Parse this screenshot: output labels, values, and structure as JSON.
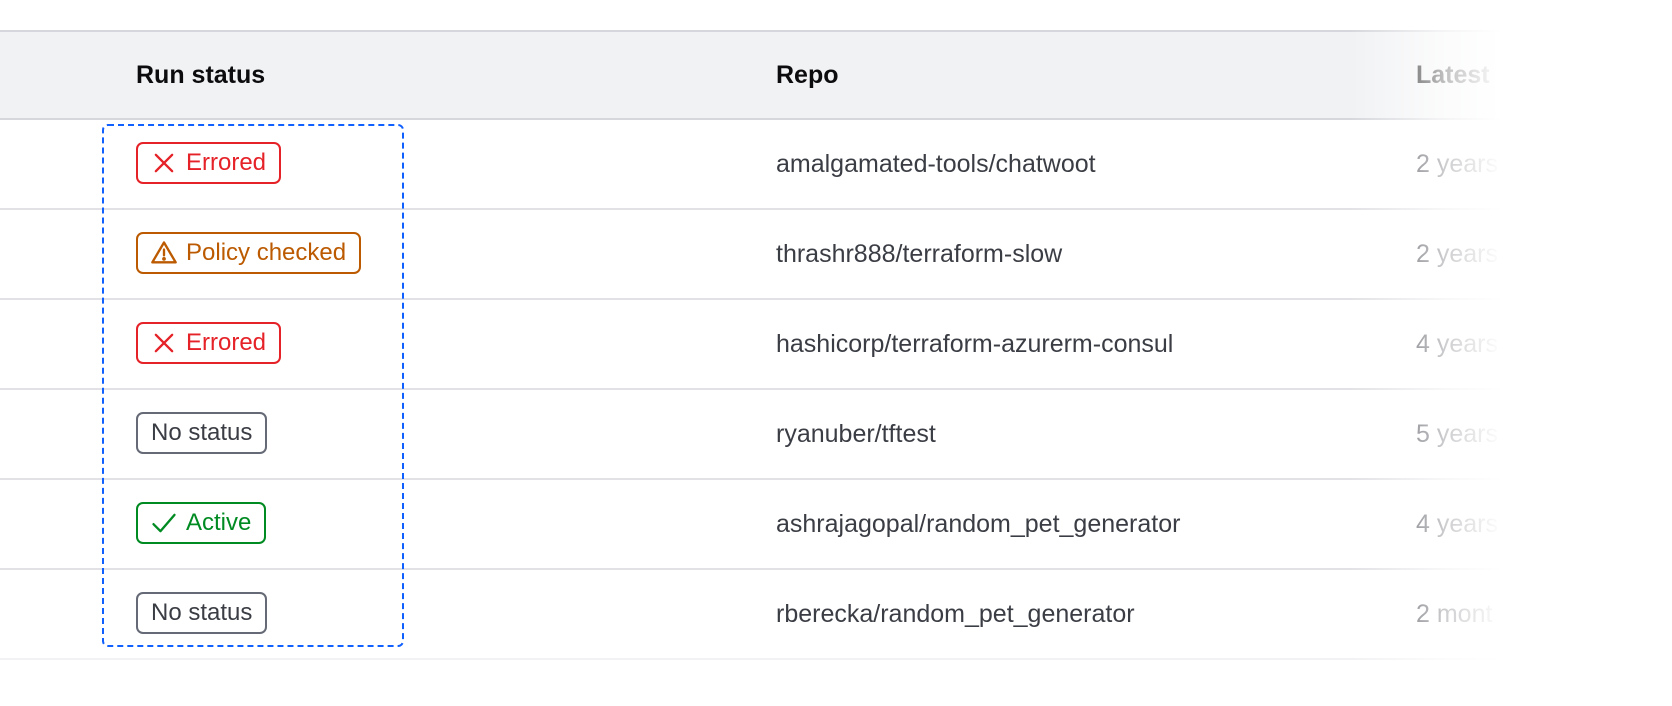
{
  "table": {
    "columns": [
      {
        "key": "run_status",
        "label": "Run status"
      },
      {
        "key": "repo",
        "label": "Repo"
      },
      {
        "key": "latest",
        "label": "Latest"
      }
    ],
    "rows": [
      {
        "status": {
          "label": "Errored",
          "variant": "errored",
          "icon": "x-icon"
        },
        "repo": "amalgamated-tools/chatwoot",
        "latest": "2 years"
      },
      {
        "status": {
          "label": "Policy checked",
          "variant": "policy",
          "icon": "warning-triangle-icon"
        },
        "repo": "thrashr888/terraform-slow",
        "latest": "2 years"
      },
      {
        "status": {
          "label": "Errored",
          "variant": "errored",
          "icon": "x-icon"
        },
        "repo": "hashicorp/terraform-azurerm-consul",
        "latest": "4 years"
      },
      {
        "status": {
          "label": "No status",
          "variant": "neutral",
          "icon": ""
        },
        "repo": "ryanuber/tftest",
        "latest": "5 years"
      },
      {
        "status": {
          "label": "Active",
          "variant": "active",
          "icon": "check-icon"
        },
        "repo": "ashrajagopal/random_pet_generator",
        "latest": "4 years"
      },
      {
        "status": {
          "label": "No status",
          "variant": "neutral",
          "icon": ""
        },
        "repo": "rberecka/random_pet_generator",
        "latest": "2 mont"
      }
    ]
  },
  "colors": {
    "errored": "#e52228",
    "policy": "#bb5a00",
    "neutral": "#656a76",
    "active": "#008a22",
    "focus": "#1060ff",
    "header_bg": "#f1f2f4"
  }
}
